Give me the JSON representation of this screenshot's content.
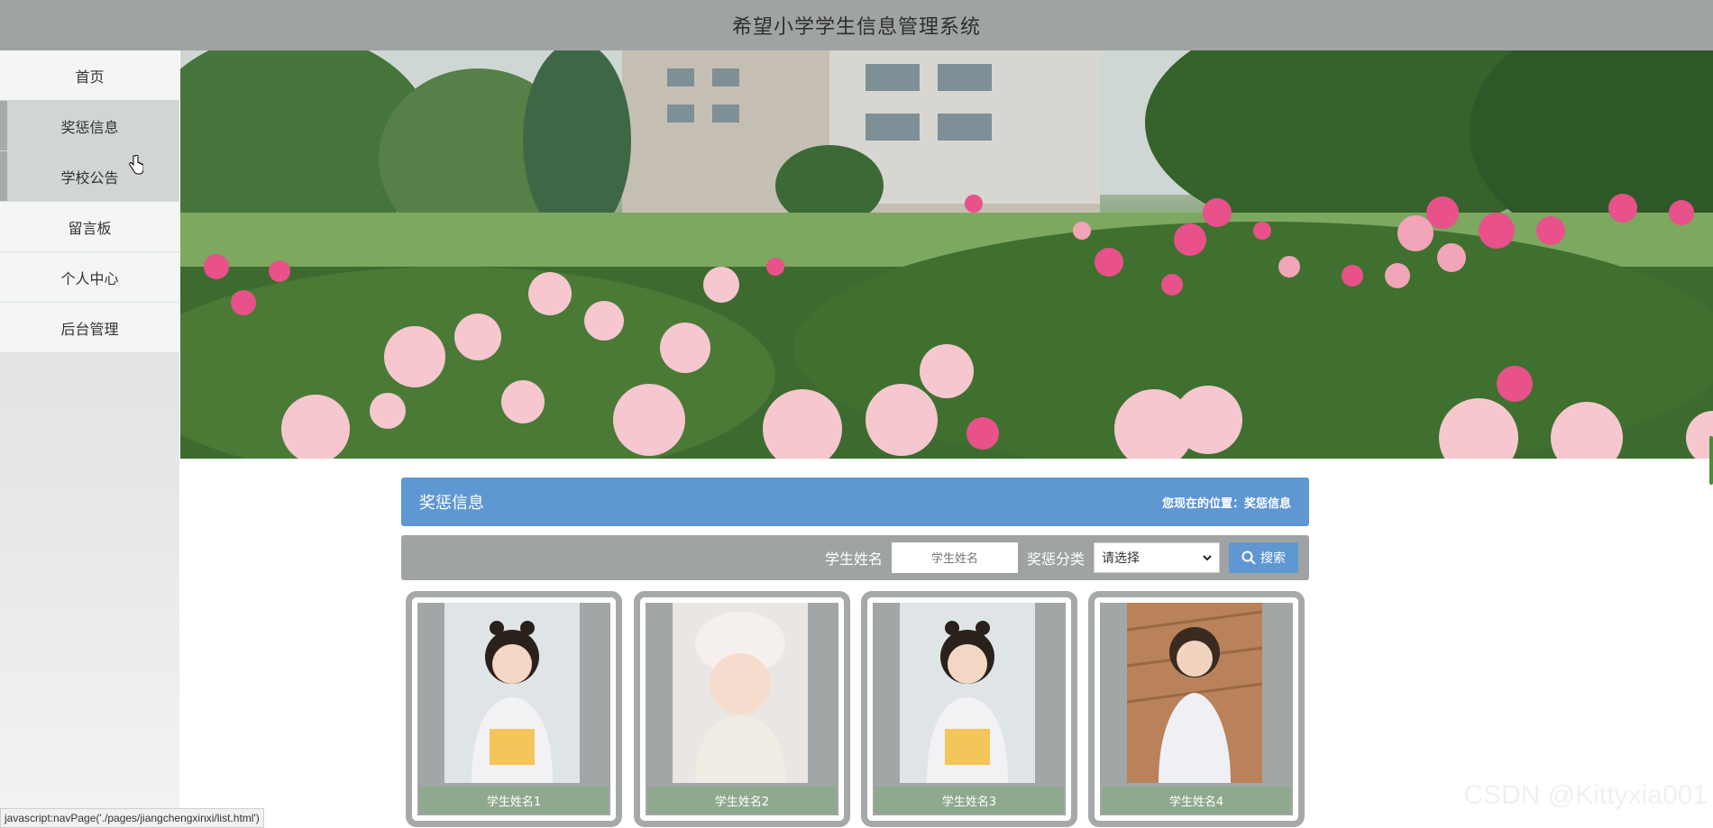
{
  "header": {
    "title": "希望小学学生信息管理系统"
  },
  "sidebar": {
    "items": [
      {
        "label": "首页"
      },
      {
        "label": "奖惩信息"
      },
      {
        "label": "学校公告"
      },
      {
        "label": "留言板"
      },
      {
        "label": "个人中心"
      },
      {
        "label": "后台管理"
      }
    ]
  },
  "section": {
    "title": "奖惩信息",
    "location": "您现在的位置：奖惩信息"
  },
  "search": {
    "name_label": "学生姓名",
    "name_placeholder": "学生姓名",
    "category_label": "奖惩分类",
    "category_selected": "请选择",
    "button_label": "搜索"
  },
  "cards": [
    {
      "name": "学生姓名1"
    },
    {
      "name": "学生姓名2"
    },
    {
      "name": "学生姓名3"
    },
    {
      "name": "学生姓名4"
    }
  ],
  "statusbar": {
    "text": "javascript:navPage('./pages/jiangchengxinxi/list.html')"
  },
  "watermark": {
    "text": "CSDN @Kittyxia001"
  },
  "colors": {
    "accent": "#5f97d3",
    "header_bg": "#a0a3a3",
    "name_bar": "#8fa98e"
  }
}
